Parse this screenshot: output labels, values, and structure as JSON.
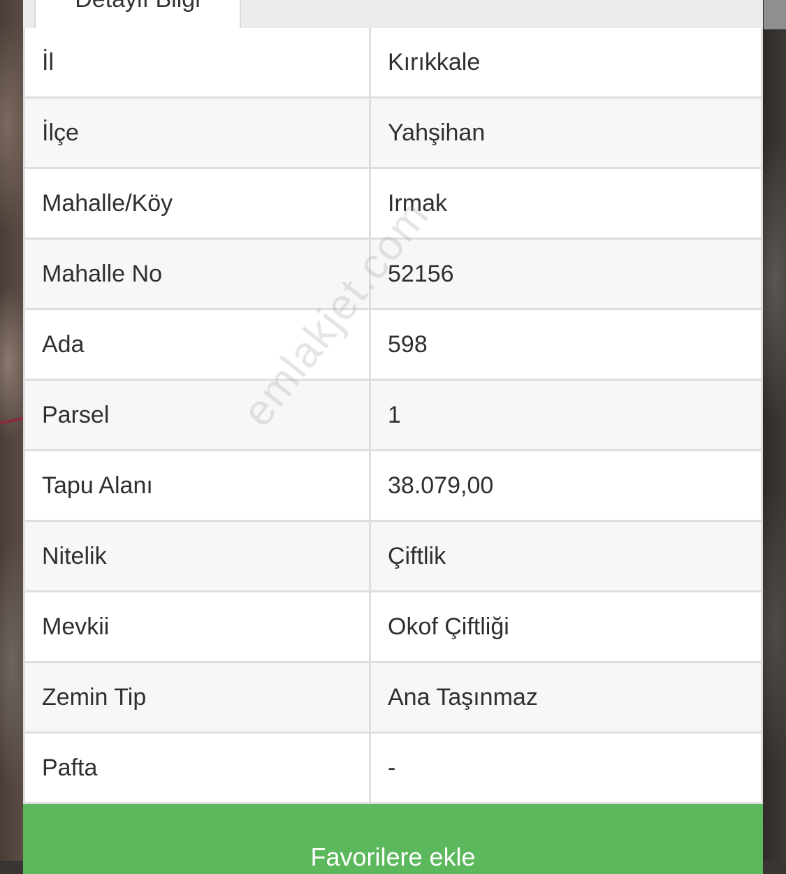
{
  "tabs": {
    "active_label": "Detaylı Bilgi"
  },
  "watermark": "emlakjet.com",
  "details": [
    {
      "key": "İl",
      "value": "Kırıkkale"
    },
    {
      "key": "İlçe",
      "value": "Yahşihan"
    },
    {
      "key": "Mahalle/Köy",
      "value": "Irmak"
    },
    {
      "key": "Mahalle No",
      "value": "52156"
    },
    {
      "key": "Ada",
      "value": "598"
    },
    {
      "key": "Parsel",
      "value": "1"
    },
    {
      "key": "Tapu Alanı",
      "value": "38.079,00"
    },
    {
      "key": "Nitelik",
      "value": "Çiftlik"
    },
    {
      "key": "Mevkii",
      "value": "Okof Çiftliği"
    },
    {
      "key": "Zemin Tip",
      "value": "Ana Taşınmaz"
    },
    {
      "key": "Pafta",
      "value": "-"
    }
  ],
  "favorite_button": "Favorilere ekle",
  "colors": {
    "button_green": "#5cb85c",
    "route_line": "#8a2a3a"
  }
}
